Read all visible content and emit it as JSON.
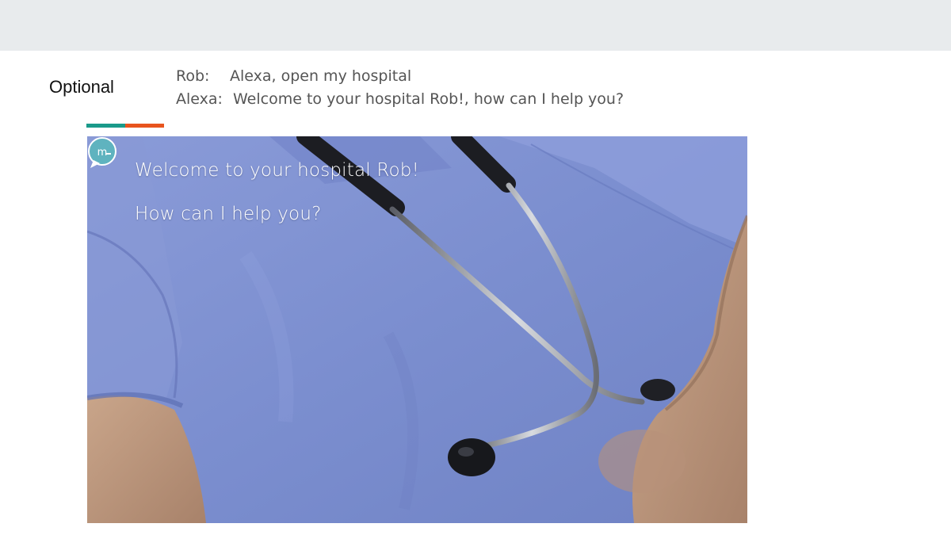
{
  "slide": {
    "section_label": "Optional"
  },
  "dialog": {
    "lines": [
      {
        "speaker": "Rob:",
        "text": "Alexa, open my hospital"
      },
      {
        "speaker": "Alexa:",
        "text": "Welcome to your hospital Rob!, how can I help you?"
      }
    ]
  },
  "screen": {
    "welcome_text": "Welcome to your hospital Rob!",
    "help_text": "How can I help you?",
    "logo_letter": "m"
  },
  "colors": {
    "top_band": "#e8ebed",
    "accent_teal": "#1a9a8a",
    "accent_orange": "#e8541e",
    "scrubs": "#7c8fd0",
    "logo_bg": "#5fb3bf"
  }
}
